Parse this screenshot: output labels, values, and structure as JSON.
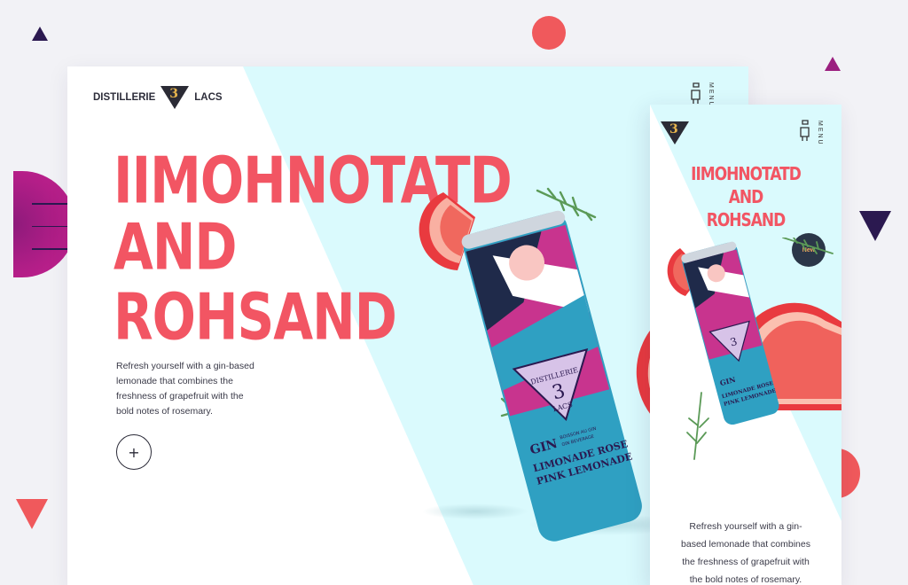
{
  "brand": {
    "name_left": "DISTILLERIE",
    "badge_mark": "3",
    "name_right": "LACS"
  },
  "nav": {
    "menu_label": "MENU"
  },
  "desktop": {
    "hero_title_lines": [
      "IIMOHNOTATD",
      "AND",
      "ROHSAND"
    ],
    "description": [
      "Refresh yourself with a gin-based",
      "lemonade that combines the",
      "freshness of grapefruit with the",
      "bold notes of rosemary."
    ],
    "add_button": "+"
  },
  "mobile": {
    "hero_title_lines": [
      "IIMOHNOTATD",
      "AND",
      "ROHSAND"
    ],
    "badge": "New",
    "description": [
      "Refresh yourself with a gin-",
      "based lemonade that combines",
      "the freshness of grapefruit with",
      "the bold notes of rosemary."
    ]
  },
  "can": {
    "brand_top": "DISTILLERIE",
    "number": "3",
    "brand_bottom": "LACS",
    "spirit": "GIN",
    "sub_fr": "BOISSON AU GIN",
    "sub_en": "GIN BEVERAGE",
    "product_fr": "LIMONADE ROSE",
    "product_en": "PINK LEMONADE"
  },
  "colors": {
    "accent": "#f25563",
    "cyan": "#dafafd",
    "navy": "#2b1950",
    "can_teal": "#2fa0c2",
    "can_pink": "#c8348e"
  }
}
